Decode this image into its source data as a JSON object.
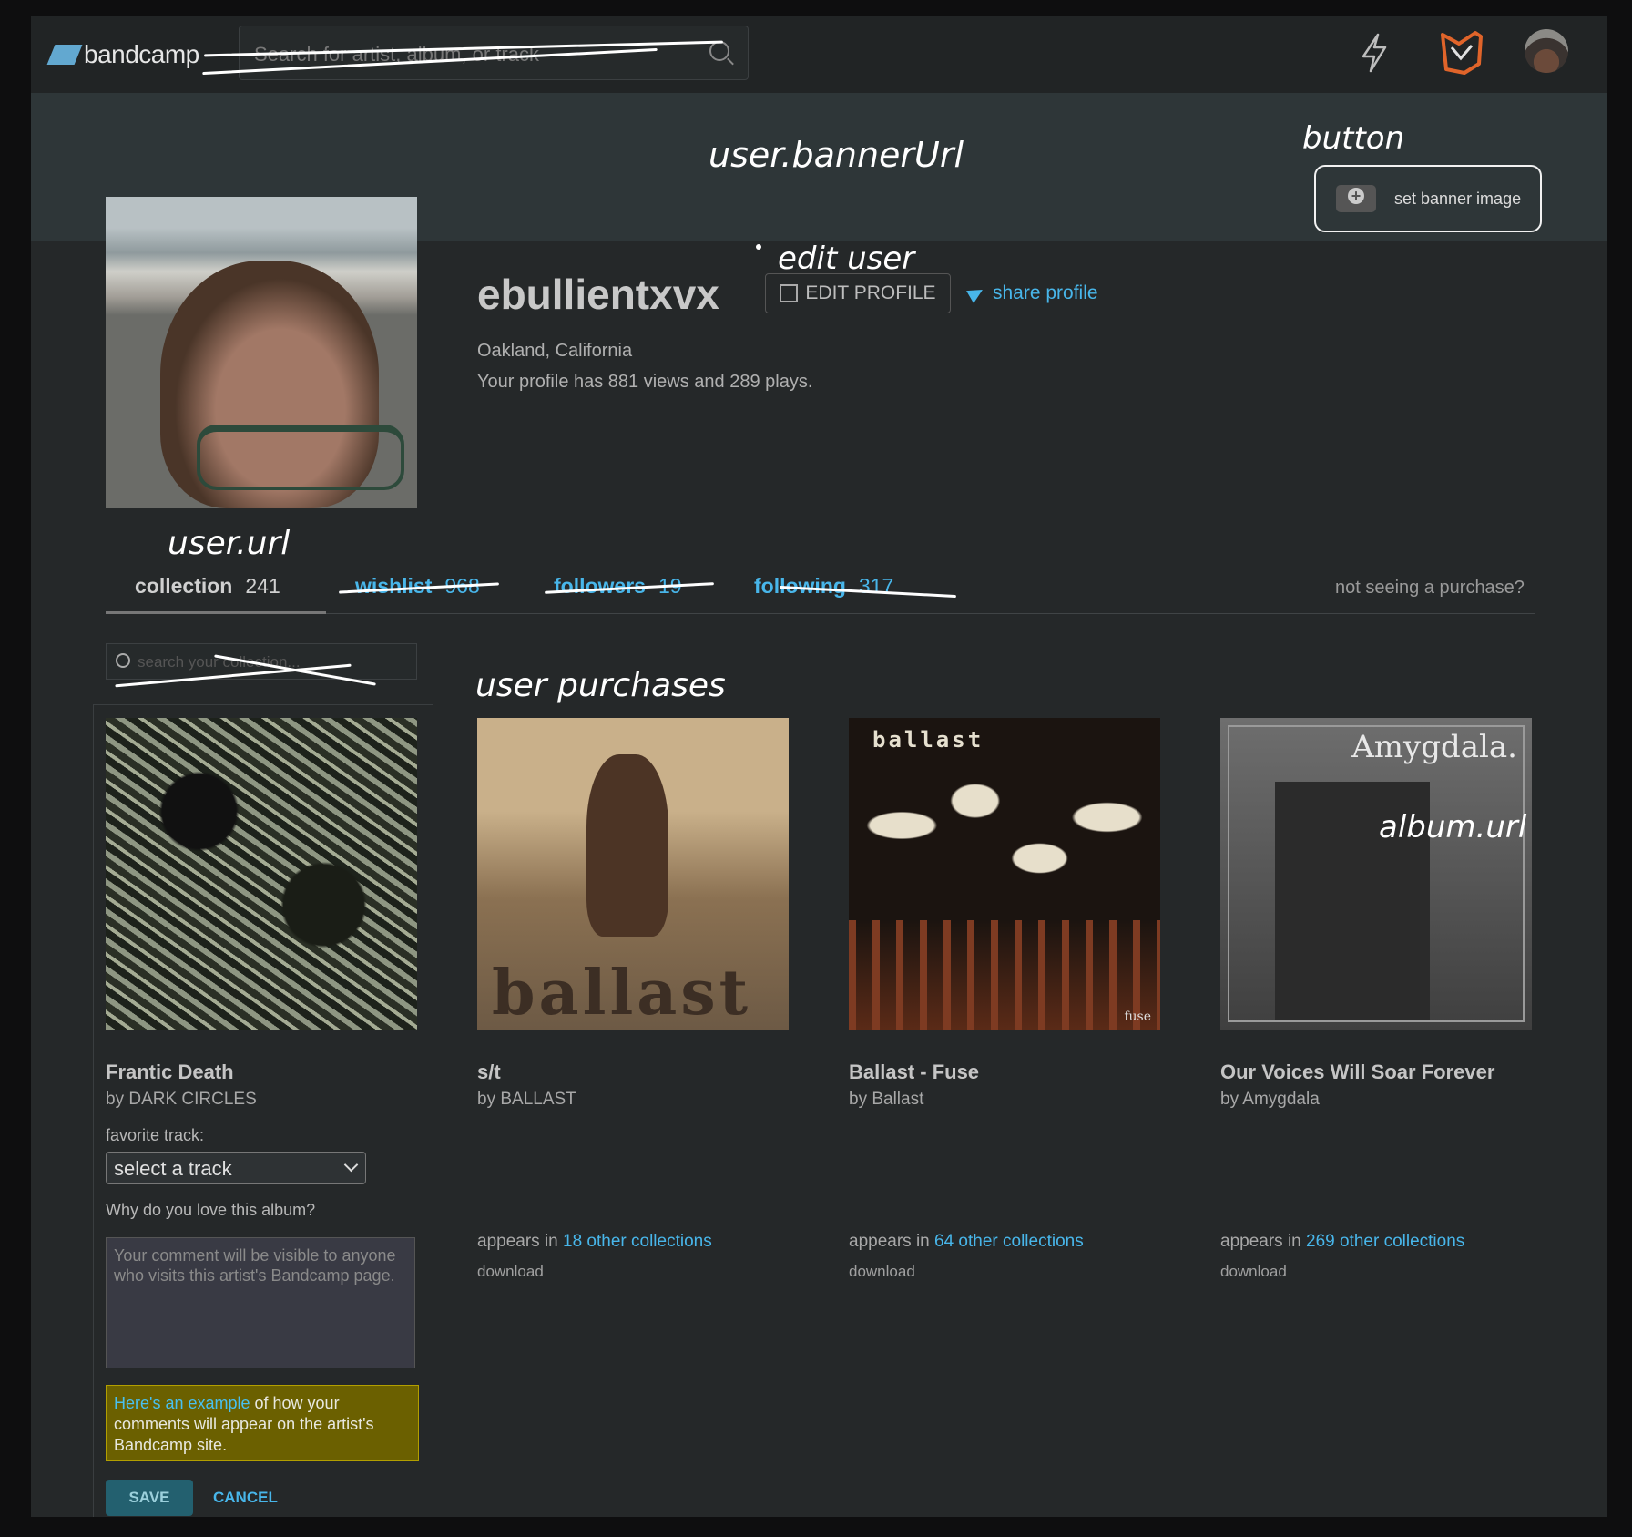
{
  "header": {
    "logo_text": "bandcamp",
    "search_placeholder": "Search for artist, album, or track"
  },
  "banner": {
    "annotation": "user.bannerUrl",
    "button_annotation": "button",
    "set_banner_label": "set banner image"
  },
  "profile": {
    "username": "ebullientxvx",
    "edit_annotation": "edit user",
    "edit_label": "EDIT PROFILE",
    "share_label": "share profile",
    "location": "Oakland, California",
    "views_text": "Your profile has 881 views and 289 plays."
  },
  "tabs": {
    "annotation": "user.url",
    "items": [
      {
        "label": "collection",
        "count": "241"
      },
      {
        "label": "wishlist",
        "count": "968"
      },
      {
        "label": "followers",
        "count": "19"
      },
      {
        "label": "following",
        "count": "317"
      }
    ],
    "not_seeing": "not seeing a purchase?"
  },
  "collection": {
    "search_placeholder": "search your collection...",
    "purchases_annotation": "user purchases",
    "album_annotation": "album.url",
    "albums": [
      {
        "title": "Frantic Death",
        "artist": "by DARK CIRCLES"
      },
      {
        "title": "s/t",
        "artist": "by BALLAST",
        "appears_prefix": "appears in",
        "appears_link": "18 other collections",
        "download": "download",
        "cover_text": "ballast"
      },
      {
        "title": "Ballast - Fuse",
        "artist": "by Ballast",
        "appears_prefix": "appears in",
        "appears_link": "64 other collections",
        "download": "download",
        "cover_text": "ballast",
        "cover_subtext": "fuse"
      },
      {
        "title": "Our Voices Will Soar Forever",
        "artist": "by Amygdala",
        "appears_prefix": "appears in",
        "appears_link": "269 other collections",
        "download": "download",
        "cover_text": "Amygdala."
      }
    ]
  },
  "featured": {
    "favorite_label": "favorite track:",
    "select_value": "select a track",
    "why_label": "Why do you love this album?",
    "comment_placeholder": "Your comment will be visible to anyone who visits this artist's Bandcamp page.",
    "tip_link": "Here's an example",
    "tip_text": " of how your comments will appear on the artist's Bandcamp site.",
    "save_label": "SAVE",
    "cancel_label": "CANCEL"
  }
}
